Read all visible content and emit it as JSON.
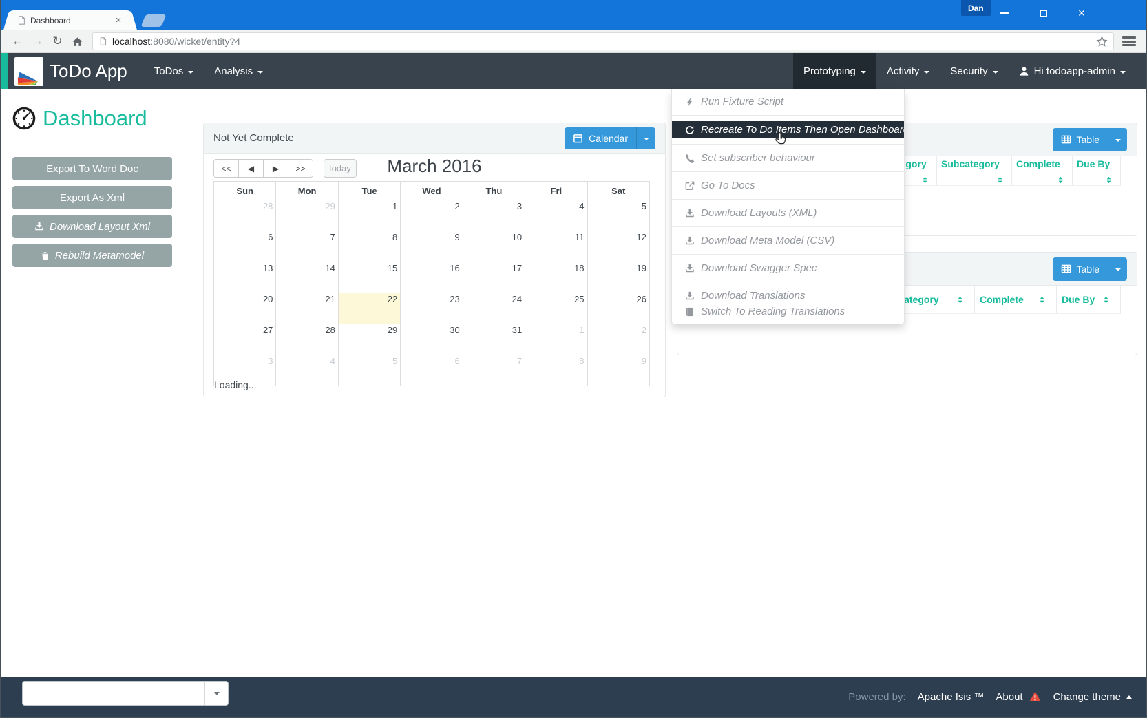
{
  "browser": {
    "tab_title": "Dashboard",
    "url_host": "localhost",
    "url_rest": ":8080/wicket/entity?4",
    "profile_name": "Dan"
  },
  "navbar": {
    "brand": "ToDo App",
    "left_items": [
      {
        "label": "ToDos"
      },
      {
        "label": "Analysis"
      }
    ],
    "right_items": [
      {
        "label": "Prototyping",
        "active": true
      },
      {
        "label": "Activity"
      },
      {
        "label": "Security"
      },
      {
        "label": "Hi todoapp-admin",
        "icon": "user"
      }
    ]
  },
  "prototyping_menu": {
    "groups": [
      [
        {
          "icon": "lightning",
          "label": "Run Fixture Script"
        }
      ],
      [
        {
          "icon": "refresh",
          "label": "Recreate To Do Items Then Open Dashboard",
          "highlighted": true
        }
      ],
      [
        {
          "icon": "phone",
          "label": "Set subscriber behaviour"
        }
      ],
      [
        {
          "icon": "external",
          "label": "Go To Docs"
        }
      ],
      [
        {
          "icon": "download",
          "label": "Download Layouts (XML)"
        }
      ],
      [
        {
          "icon": "download",
          "label": "Download Meta Model (CSV)"
        }
      ],
      [
        {
          "icon": "download",
          "label": "Download Swagger Spec"
        }
      ],
      [
        {
          "icon": "download",
          "label": "Download Translations"
        },
        {
          "icon": "book",
          "label": "Switch To Reading Translations"
        }
      ]
    ]
  },
  "sidebar": {
    "title": "Dashboard",
    "buttons": [
      {
        "label": "Export To Word Doc"
      },
      {
        "label": "Export As Xml"
      },
      {
        "label": "Download Layout Xml",
        "icon": "download",
        "italic": true
      },
      {
        "label": "Rebuild Metamodel",
        "icon": "trash",
        "italic": true
      }
    ]
  },
  "calendar_panel": {
    "title": "Not Yet Complete",
    "view_button": "Calendar",
    "nav_buttons": [
      "<<",
      "◀",
      "▶",
      ">>"
    ],
    "today_button": "today",
    "month_title": "March 2016",
    "weekdays": [
      "Sun",
      "Mon",
      "Tue",
      "Wed",
      "Thu",
      "Fri",
      "Sat"
    ],
    "weeks": [
      [
        {
          "d": 28,
          "m": 1
        },
        {
          "d": 29,
          "m": 1
        },
        {
          "d": 1
        },
        {
          "d": 2
        },
        {
          "d": 3
        },
        {
          "d": 4
        },
        {
          "d": 5
        }
      ],
      [
        {
          "d": 6
        },
        {
          "d": 7
        },
        {
          "d": 8
        },
        {
          "d": 9
        },
        {
          "d": 10
        },
        {
          "d": 11
        },
        {
          "d": 12
        }
      ],
      [
        {
          "d": 13
        },
        {
          "d": 14
        },
        {
          "d": 15
        },
        {
          "d": 16
        },
        {
          "d": 17
        },
        {
          "d": 18
        },
        {
          "d": 19
        }
      ],
      [
        {
          "d": 20
        },
        {
          "d": 21
        },
        {
          "d": 22,
          "t": 1
        },
        {
          "d": 23
        },
        {
          "d": 24
        },
        {
          "d": 25
        },
        {
          "d": 26
        }
      ],
      [
        {
          "d": 27
        },
        {
          "d": 28
        },
        {
          "d": 29
        },
        {
          "d": 30
        },
        {
          "d": 31
        },
        {
          "d": 1,
          "m": 1
        },
        {
          "d": 2,
          "m": 1
        }
      ],
      [
        {
          "d": 3,
          "m": 1
        },
        {
          "d": 4,
          "m": 1
        },
        {
          "d": 5,
          "m": 1
        },
        {
          "d": 6,
          "m": 1
        },
        {
          "d": 7,
          "m": 1
        },
        {
          "d": 8,
          "m": 1
        },
        {
          "d": 9,
          "m": 1
        }
      ]
    ],
    "loading_text": "Loading..."
  },
  "tables": [
    {
      "view_button": "Table",
      "columns": [
        "Category",
        "Subcategory",
        "Complete",
        "Due By"
      ]
    },
    {
      "view_button": "Table",
      "columns": [
        "Category",
        "Complete",
        "Due By"
      ]
    }
  ],
  "footer": {
    "powered_by": "Powered by:",
    "brand": "Apache Isis ™",
    "about": "About",
    "change_theme": "Change theme"
  },
  "colors": {
    "accent_teal": "#18bc9c",
    "accent_blue": "#3498db",
    "navbar_bg": "#39434d",
    "footer_bg": "#2c3e50",
    "titlebar_blue": "#1374d9",
    "today_highlight": "#fcf8d8",
    "danger_red": "#e74c3c"
  }
}
